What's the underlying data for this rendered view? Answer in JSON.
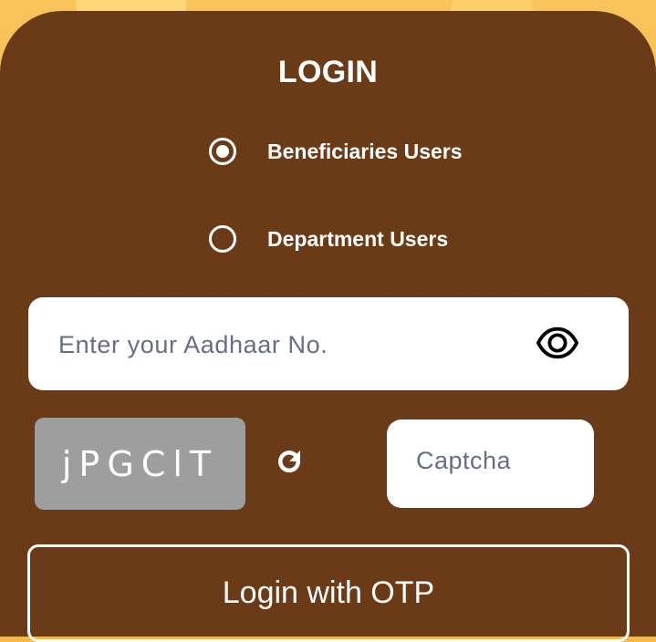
{
  "login": {
    "title": "LOGIN",
    "user_types": [
      {
        "label": "Beneficiaries Users",
        "selected": true
      },
      {
        "label": "Department Users",
        "selected": false
      }
    ],
    "aadhaar_placeholder": "Enter your Aadhaar No.",
    "captcha_text": "jPGClT",
    "captcha_placeholder": "Captcha",
    "otp_button_label": "Login with OTP"
  },
  "icons": {
    "visibility": "eye-icon",
    "refresh": "refresh-icon"
  },
  "colors": {
    "panel": "#6b3b18",
    "captcha_bg": "#9e9e9e",
    "text": "#ffffff",
    "placeholder": "#646e86"
  }
}
